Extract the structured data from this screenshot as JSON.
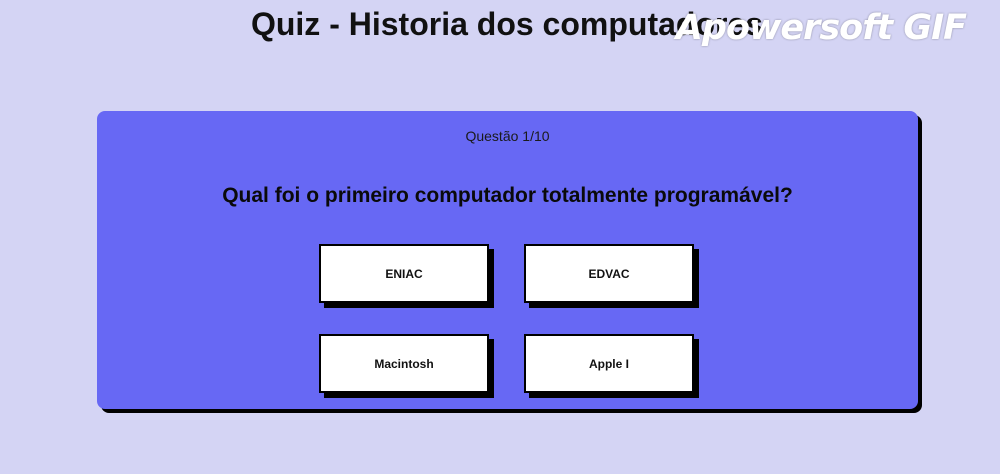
{
  "header": {
    "title": "Quiz - Historia dos computadores",
    "watermark": "Apowersoft GIF"
  },
  "quiz": {
    "counter": "Questão 1/10",
    "question": "Qual foi o primeiro computador totalmente programável?",
    "answers": [
      "ENIAC",
      "EDVAC",
      "Macintosh",
      "Apple I"
    ]
  },
  "colors": {
    "background": "#d4d4f4",
    "card": "#6768f4",
    "button": "#ffffff",
    "shadow": "#000000"
  }
}
